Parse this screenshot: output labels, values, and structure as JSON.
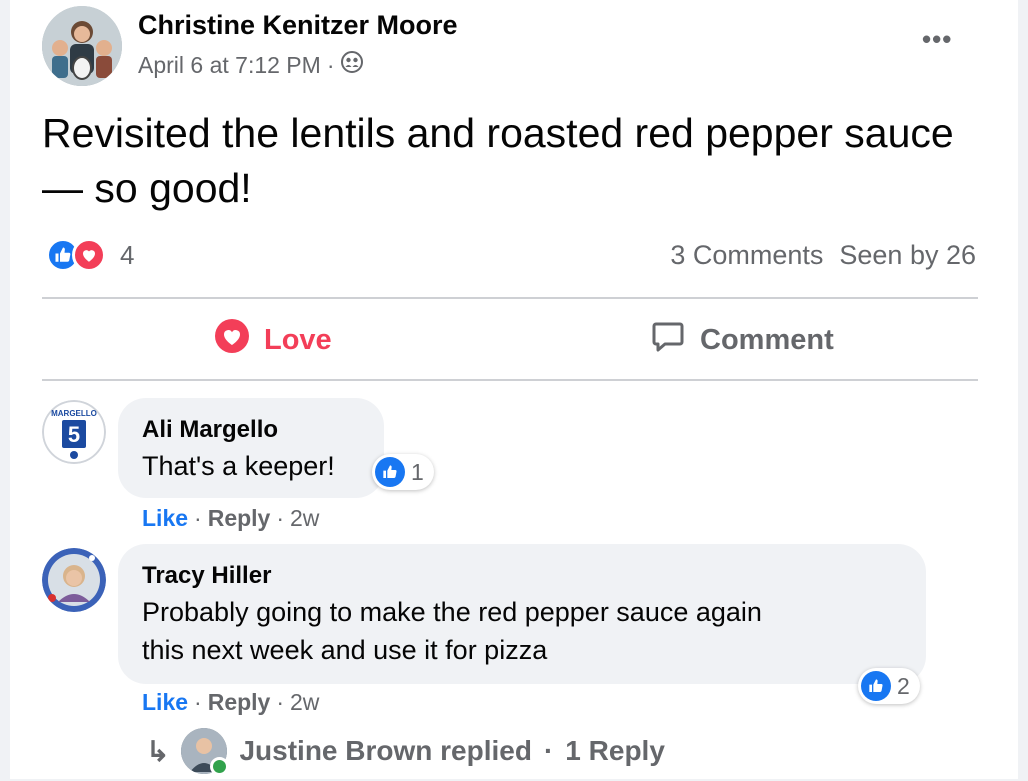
{
  "post": {
    "author": "Christine Kenitzer Moore",
    "date": "April 6 at 7:12 PM",
    "separator": "·",
    "audience_icon": "friends-icon",
    "more_label": "•••",
    "text": "Revisited the lentils and roasted red pepper sauce— so good!",
    "reaction_icons": [
      "like-icon",
      "love-icon"
    ],
    "reaction_count": "4",
    "comments_count": "3 Comments",
    "seen_by": "Seen by 26"
  },
  "actions": {
    "love_label": "Love",
    "comment_label": "Comment"
  },
  "comments": [
    {
      "name": "Ali Margello",
      "text": "That's a keeper!",
      "reaction_count": "1",
      "avatar_label": "MARGELLO",
      "avatar_number": "5",
      "like_label": "Like",
      "reply_label": "Reply",
      "age": "2w"
    },
    {
      "name": "Tracy Hiller",
      "text_line1": "Probably going to make the red pepper sauce again",
      "text_line2": "this next week and use it for pizza",
      "reaction_count": "2",
      "like_label": "Like",
      "reply_label": "Reply",
      "age": "2w"
    }
  ],
  "replies_summary": {
    "arrow": "↳",
    "text": "Justine Brown replied",
    "count": "1 Reply",
    "separator": "·"
  },
  "colors": {
    "accent_blue": "#1877f2",
    "love_red": "#f33e58",
    "secondary_text": "#65676b",
    "bubble_bg": "#f0f2f5"
  }
}
